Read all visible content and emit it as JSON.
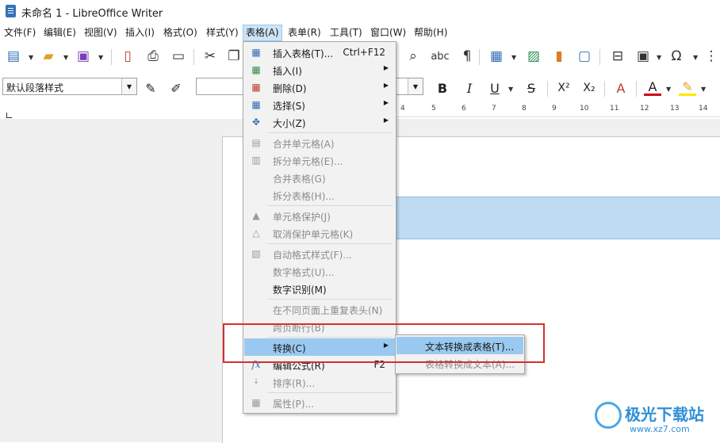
{
  "window": {
    "title": "未命名 1 - LibreOffice Writer"
  },
  "menubar": [
    {
      "label": "文件(F)"
    },
    {
      "label": "编辑(E)"
    },
    {
      "label": "视图(V)"
    },
    {
      "label": "插入(I)"
    },
    {
      "label": "格式(O)"
    },
    {
      "label": "样式(Y)"
    },
    {
      "label": "表格(A)"
    },
    {
      "label": "表单(R)"
    },
    {
      "label": "工具(T)"
    },
    {
      "label": "窗口(W)"
    },
    {
      "label": "帮助(H)"
    }
  ],
  "formatting": {
    "paragraph_style": "默认段落样式",
    "font_name": "",
    "superscript": "X²",
    "subscript": "X₂"
  },
  "ruler_numbers": [
    "4",
    "5",
    "6",
    "7",
    "8",
    "9",
    "10",
    "11",
    "12",
    "13",
    "14"
  ],
  "table_menu": {
    "items": [
      {
        "label": "插入表格(T)...",
        "shortcut": "Ctrl+F12"
      },
      {
        "label": "插入(I)"
      },
      {
        "label": "删除(D)"
      },
      {
        "label": "选择(S)"
      },
      {
        "label": "大小(Z)"
      },
      {
        "label": "合并单元格(A)"
      },
      {
        "label": "拆分单元格(E)..."
      },
      {
        "label": "合并表格(G)"
      },
      {
        "label": "拆分表格(H)..."
      },
      {
        "label": "单元格保护(J)"
      },
      {
        "label": "取消保护单元格(K)"
      },
      {
        "label": "自动格式样式(F)..."
      },
      {
        "label": "数字格式(U)..."
      },
      {
        "label": "数字识别(M)"
      },
      {
        "label": "在不同页面上重复表头(N)"
      },
      {
        "label": "跨页断行(B)"
      },
      {
        "label": "转换(C)"
      },
      {
        "label": "编辑公式(R)",
        "shortcut": "F2"
      },
      {
        "label": "排序(R)..."
      },
      {
        "label": "属性(P)..."
      }
    ]
  },
  "convert_submenu": {
    "items": [
      {
        "label": "文本转换成表格(T)..."
      },
      {
        "label": "表格转换成文本(A)..."
      }
    ]
  },
  "watermark": {
    "text": "极光下载站",
    "url": "www.xz7.com"
  },
  "colors": {
    "menu_highlight": "#99c9f0",
    "callout_red": "#d62f2f",
    "selection": "#bfdcf3"
  }
}
